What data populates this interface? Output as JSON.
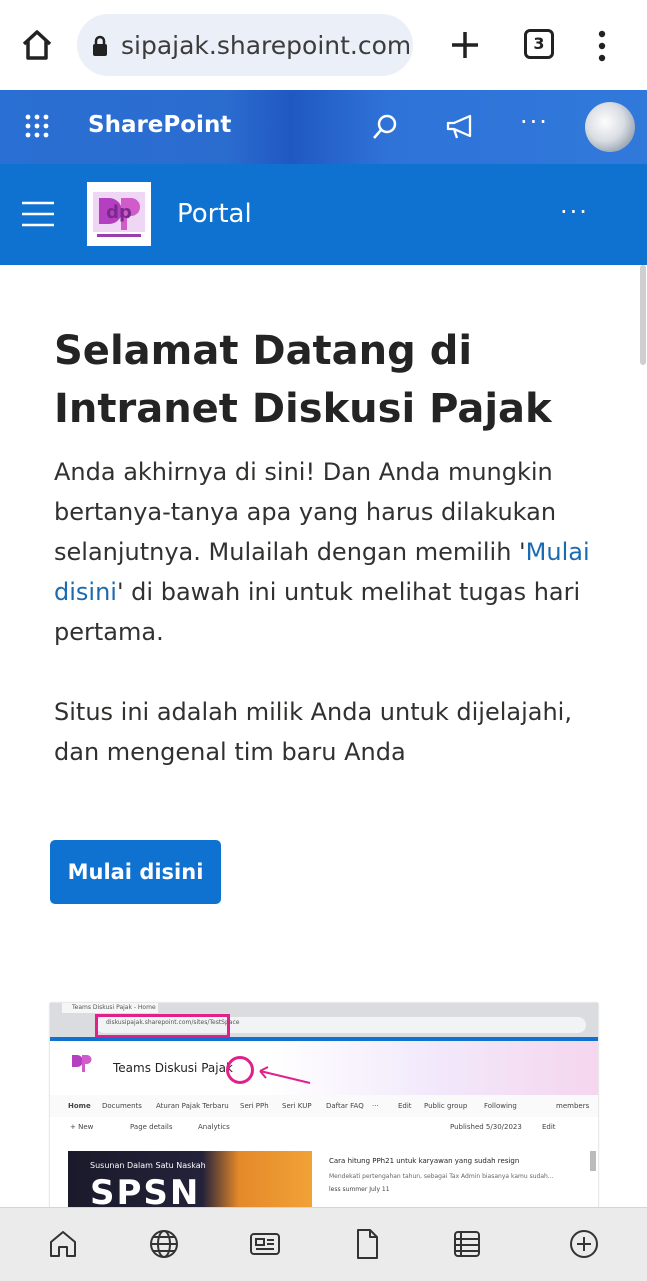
{
  "browser": {
    "url": "sipajak.sharepoint.com",
    "tab_count": "3"
  },
  "sharepoint_bar": {
    "title": "SharePoint",
    "more": "···"
  },
  "site": {
    "title": "Portal",
    "more": "···",
    "logo_text": "dp"
  },
  "content": {
    "heading": "Selamat Datang di Intranet Diskusi Pajak",
    "p1_before": "Anda akhirnya di sini! Dan Anda mungkin bertanya-tanya apa yang harus dilakukan selanjutnya. Mulailah dengan memilih '",
    "p1_link": "Mulai disini",
    "p1_after": "' di bawah ini untuk melihat tugas hari pertama.",
    "p2": "Situs ini adalah milik Anda untuk dijelajahi, dan mengenal tim baru Anda",
    "button": "Mulai disini"
  },
  "preview": {
    "tab_label": "Teams Diskusi Pajak - Home",
    "url": "diskusipajak.sharepoint.com/sites/TestSpace",
    "title": "Teams Diskusi Pajak",
    "nav": [
      "Home",
      "Documents",
      "Aturan Pajak Terbaru",
      "Seri PPh",
      "Seri KUP",
      "Daftar FAQ",
      "···",
      "Edit",
      "Public group",
      "Following",
      "members"
    ],
    "cmd": [
      "+ New",
      "Page details",
      "Analytics",
      "Published 5/30/2023",
      "Edit"
    ],
    "hero_small": "Susunan Dalam Satu Naskah",
    "hero_big": "SPSN",
    "news_title": "Cara hitung PPh21 untuk karyawan yang sudah resign",
    "news_snippet": "Mendekati pertengahan tahun, sebagai Tax Admin biasanya kamu sudah...",
    "news_meta": "less summer  July 11"
  },
  "bottom_nav": [
    "home-icon",
    "globe-icon",
    "news-icon",
    "file-icon",
    "list-icon",
    "add-circle-icon"
  ]
}
